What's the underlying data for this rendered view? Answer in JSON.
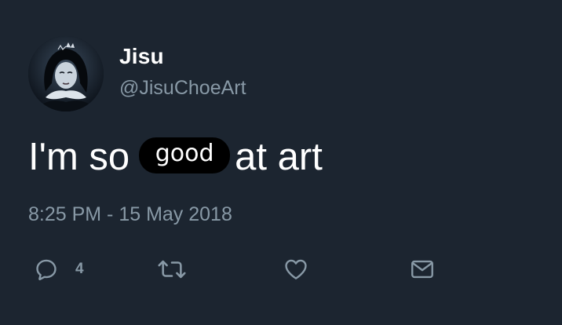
{
  "user": {
    "display_name": "Jisu",
    "handle": "@JisuChoeArt",
    "avatar_icon": "profile-photo"
  },
  "tweet": {
    "text_before": "I'm so",
    "redacted_word": "good",
    "text_after": "at art",
    "timestamp": "8:25 PM - 15 May 2018"
  },
  "actions": {
    "reply": {
      "icon": "reply-icon",
      "count": "4"
    },
    "retweet": {
      "icon": "retweet-icon"
    },
    "like": {
      "icon": "heart-icon"
    },
    "message": {
      "icon": "envelope-icon"
    }
  },
  "colors": {
    "background": "#1c2530",
    "primary_text": "#ffffff",
    "secondary_text": "#8899a6",
    "redaction": "#000000"
  }
}
